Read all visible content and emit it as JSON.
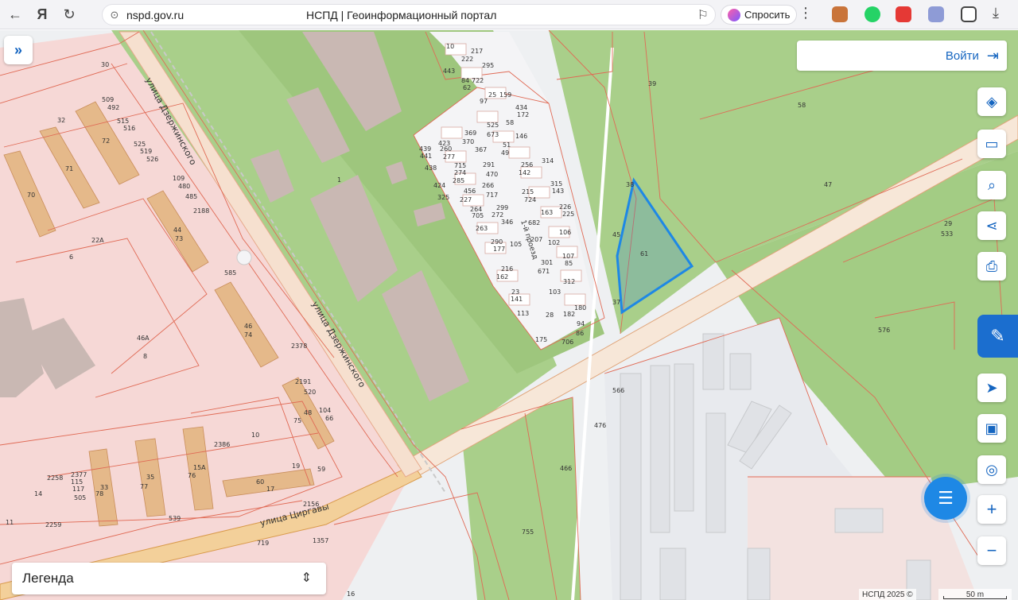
{
  "browser": {
    "url": "nspd.gov.ru",
    "page_title": "НСПД | Геоинформационный портал",
    "ask_label": "Спросить"
  },
  "map": {
    "login_label": "Войти",
    "legend_label": "Легенда",
    "copyright": "НСПД 2025 ©",
    "scale_label": "50 m",
    "streets": {
      "dzerzhinskogo_1": "улица Дзержинского",
      "dzerzhinskogo_2": "улица Дзержинского",
      "tsirgavy": "улица Циргавы",
      "proezd": "1-й проезд"
    },
    "selected_parcel": "61",
    "parcel_numbers": [
      "30",
      "509",
      "492",
      "515",
      "516",
      "525",
      "519",
      "526",
      "32",
      "72",
      "71",
      "70",
      "109",
      "480",
      "485",
      "2188",
      "22А",
      "6",
      "44",
      "73",
      "585",
      "46А",
      "8",
      "46",
      "74",
      "2378",
      "2191",
      "520",
      "48",
      "104",
      "66",
      "75",
      "10",
      "2386",
      "19",
      "59",
      "60",
      "17",
      "15А",
      "76",
      "35",
      "77",
      "33",
      "78",
      "2377",
      "115",
      "117",
      "505",
      "2258",
      "14",
      "11",
      "2259",
      "2156",
      "539",
      "719",
      "1357",
      "16",
      "1",
      "10",
      "217",
      "222",
      "295",
      "443",
      "84",
      "722",
      "62",
      "97",
      "25",
      "159",
      "434",
      "172",
      "525",
      "58",
      "673",
      "146",
      "423",
      "369",
      "260",
      "370",
      "277",
      "367",
      "51",
      "49",
      "439",
      "441",
      "438",
      "291",
      "470",
      "256",
      "142",
      "314",
      "715",
      "274",
      "285",
      "456",
      "227",
      "705",
      "266",
      "717",
      "299",
      "272",
      "346",
      "215",
      "724",
      "315",
      "143",
      "424",
      "325",
      "263",
      "264",
      "290",
      "177",
      "105",
      "682",
      "207",
      "102",
      "226",
      "225",
      "163",
      "106",
      "216",
      "162",
      "301",
      "671",
      "107",
      "85",
      "312",
      "23",
      "141",
      "103",
      "113",
      "28",
      "180",
      "182",
      "94",
      "86",
      "706",
      "175",
      "39",
      "58",
      "38",
      "45",
      "37",
      "47",
      "533",
      "29",
      "576",
      "566",
      "476",
      "466",
      "755"
    ]
  },
  "icons": {
    "layers": "layers-icon",
    "ruler": "ruler-icon",
    "search_area": "area-search-icon",
    "share": "share-icon",
    "print": "print-icon",
    "locate": "locate-icon",
    "minimap": "minimap-icon",
    "geo": "geolocation-icon",
    "zoom_in": "zoom-in-icon",
    "zoom_out": "zoom-out-icon"
  },
  "colors": {
    "parcel_border": "#e06a55",
    "selected_border": "#1e88e5",
    "green": "#a9cf8a",
    "accent": "#1565c0"
  }
}
